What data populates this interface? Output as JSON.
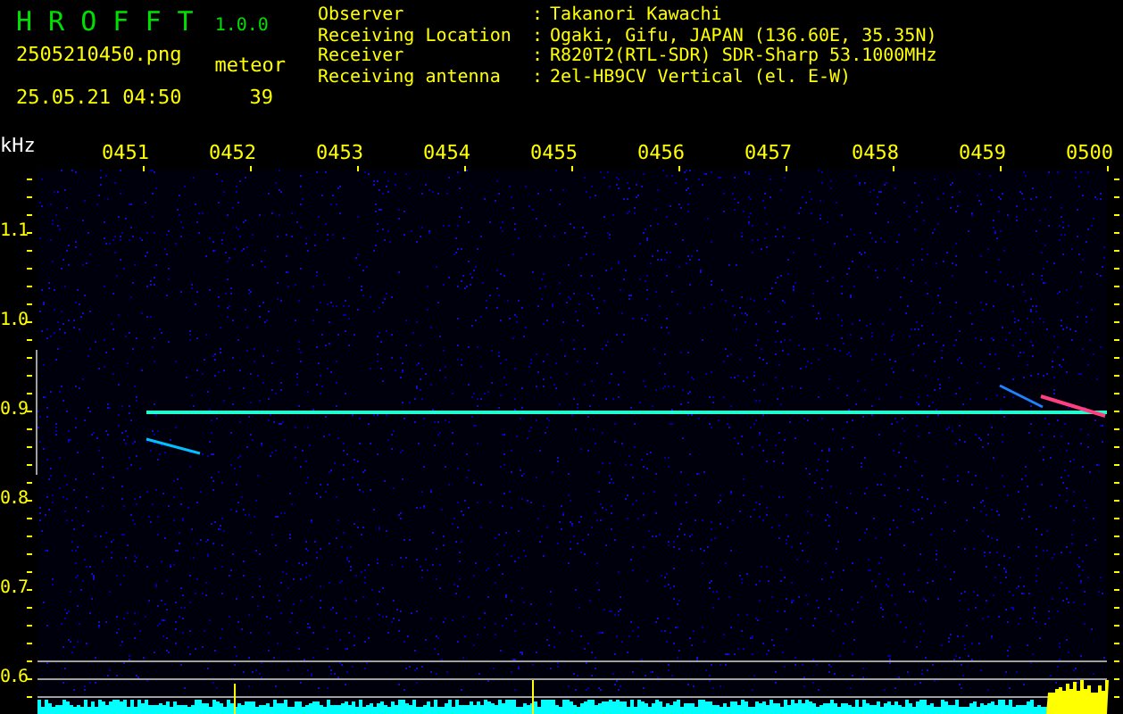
{
  "app": {
    "name": "H R O F F T",
    "version": "1.0.0"
  },
  "file": {
    "name": "2505210450.png",
    "timestamp": "25.05.21 04:50"
  },
  "meteor": {
    "label": "meteor",
    "count": "39"
  },
  "station": [
    {
      "label": "Observer",
      "separator": ":",
      "value": "Takanori Kawachi"
    },
    {
      "label": "Receiving Location",
      "separator": ":",
      "value": "Ogaki, Gifu, JAPAN (136.60E, 35.35N)"
    },
    {
      "label": "Receiver",
      "separator": ":",
      "value": "R820T2(RTL-SDR) SDR-Sharp 53.1000MHz"
    },
    {
      "label": "Receiving antenna",
      "separator": ":",
      "value": "2el-HB9CV Vertical (el. E-W)"
    }
  ],
  "spectrogram": {
    "unit": "kHz",
    "time_labels": [
      "0451",
      "0452",
      "0453",
      "0454",
      "0455",
      "0456",
      "0457",
      "0458",
      "0459",
      "0500"
    ],
    "freq_labels": [
      "1.1",
      "1.0",
      "0.9",
      "0.8",
      "0.7",
      "0.6"
    ]
  }
}
